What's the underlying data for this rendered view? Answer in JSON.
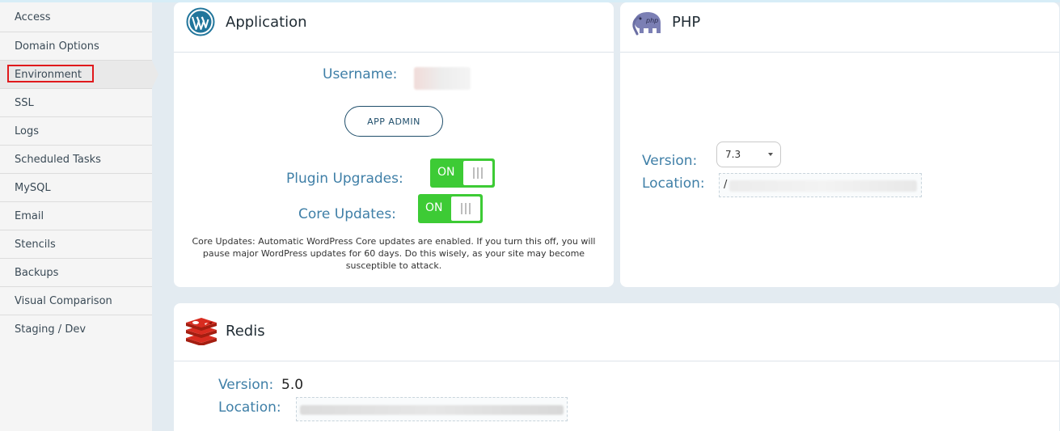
{
  "sidebar": {
    "items": [
      {
        "label": "Access"
      },
      {
        "label": "Domain Options"
      },
      {
        "label": "Environment"
      },
      {
        "label": "SSL"
      },
      {
        "label": "Logs"
      },
      {
        "label": "Scheduled Tasks"
      },
      {
        "label": "MySQL"
      },
      {
        "label": "Email"
      },
      {
        "label": "Stencils"
      },
      {
        "label": "Backups"
      },
      {
        "label": "Visual Comparison"
      },
      {
        "label": "Staging / Dev"
      }
    ],
    "active_index": 2
  },
  "application": {
    "title": "Application",
    "icon": "wordpress-logo",
    "username_label": "Username:",
    "app_admin_label": "APP ADMIN",
    "plugin_upgrades_label": "Plugin Upgrades:",
    "plugin_upgrades_state": "ON",
    "core_updates_label": "Core Updates:",
    "core_updates_state": "ON",
    "note": "Core Updates: Automatic WordPress Core updates are enabled. If you turn this off, you will pause major WordPress updates for 60 days. Do this wisely, as your site may become susceptible to attack."
  },
  "php": {
    "title": "PHP",
    "icon": "php-elephant",
    "version_label": "Version:",
    "version_value": "7.3",
    "location_label": "Location:",
    "location_value": "/"
  },
  "redis": {
    "title": "Redis",
    "icon": "redis-logo",
    "version_label": "Version:",
    "version_value": "5.0",
    "location_label": "Location:"
  },
  "colors": {
    "accent_label": "#3f7fa7",
    "toggle_on": "#3dcb35",
    "highlight": "#e0191c"
  }
}
